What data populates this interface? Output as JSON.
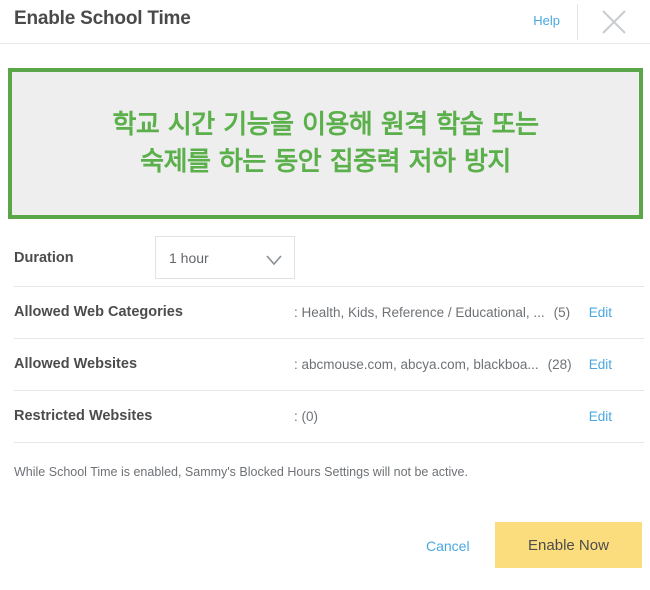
{
  "header": {
    "title": "Enable School Time",
    "help_label": "Help",
    "close_icon": "close-icon"
  },
  "banner": {
    "text": "학교 시간 기능을 이용해 원격 학습 또는\n숙제를 하는 동안 집중력 저하 방지",
    "border_color": "#5ba648",
    "background_color": "#eeeeee",
    "text_color": "#5cb04c"
  },
  "duration": {
    "label": "Duration",
    "selected_value": "1 hour",
    "caret_icon": "chevron-down-icon"
  },
  "rows": [
    {
      "label": "Allowed Web Categories",
      "value": ": Health, Kids, Reference / Educational, ...",
      "count": "(5)",
      "edit_label": "Edit"
    },
    {
      "label": "Allowed Websites",
      "value": ": abcmouse.com, abcya.com, blackboa...",
      "count": "(28)",
      "edit_label": "Edit"
    },
    {
      "label": "Restricted Websites",
      "value": ": (0)",
      "count": "",
      "edit_label": "Edit"
    }
  ],
  "note": "While School Time is enabled, Sammy's Blocked Hours Settings will not be active.",
  "footer": {
    "cancel_label": "Cancel",
    "enable_label": "Enable Now",
    "enable_color": "#fcdd7e",
    "link_color": "#4aa8e0"
  }
}
